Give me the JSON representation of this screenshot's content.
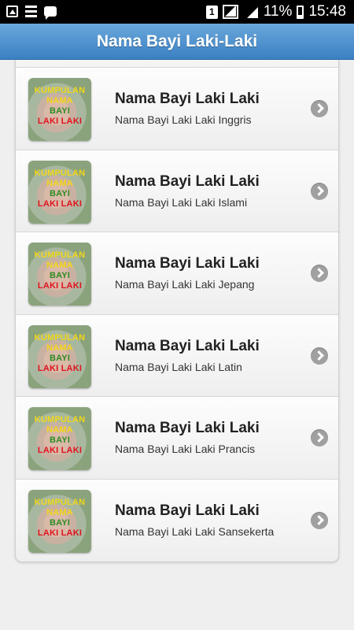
{
  "status_bar": {
    "notification_badge": "1",
    "battery": "11%",
    "time": "15:48"
  },
  "header": {
    "title": "Nama Bayi Laki-Laki"
  },
  "thumbnail_text": {
    "line1": "KUMPULAN",
    "line2": "NAMA",
    "line3": "BAYI",
    "line4": "LAKI LAKI"
  },
  "items": [
    {
      "title": "Nama Bayi Laki Laki",
      "subtitle": "Nama Bayi Laki Laki Inggris"
    },
    {
      "title": "Nama Bayi Laki Laki",
      "subtitle": "Nama Bayi Laki Laki Islami"
    },
    {
      "title": "Nama Bayi Laki Laki",
      "subtitle": "Nama Bayi Laki Laki Jepang"
    },
    {
      "title": "Nama Bayi Laki Laki",
      "subtitle": "Nama Bayi Laki Laki Latin"
    },
    {
      "title": "Nama Bayi Laki Laki",
      "subtitle": "Nama Bayi Laki Laki Prancis"
    },
    {
      "title": "Nama Bayi Laki Laki",
      "subtitle": "Nama Bayi Laki Laki Sansekerta"
    }
  ],
  "colors": {
    "header_top": "#6aa8dc",
    "header_bottom": "#3b80c2",
    "thumb_yellow": "#f2d61a",
    "thumb_green": "#2e8b22",
    "thumb_red": "#e0141e"
  }
}
